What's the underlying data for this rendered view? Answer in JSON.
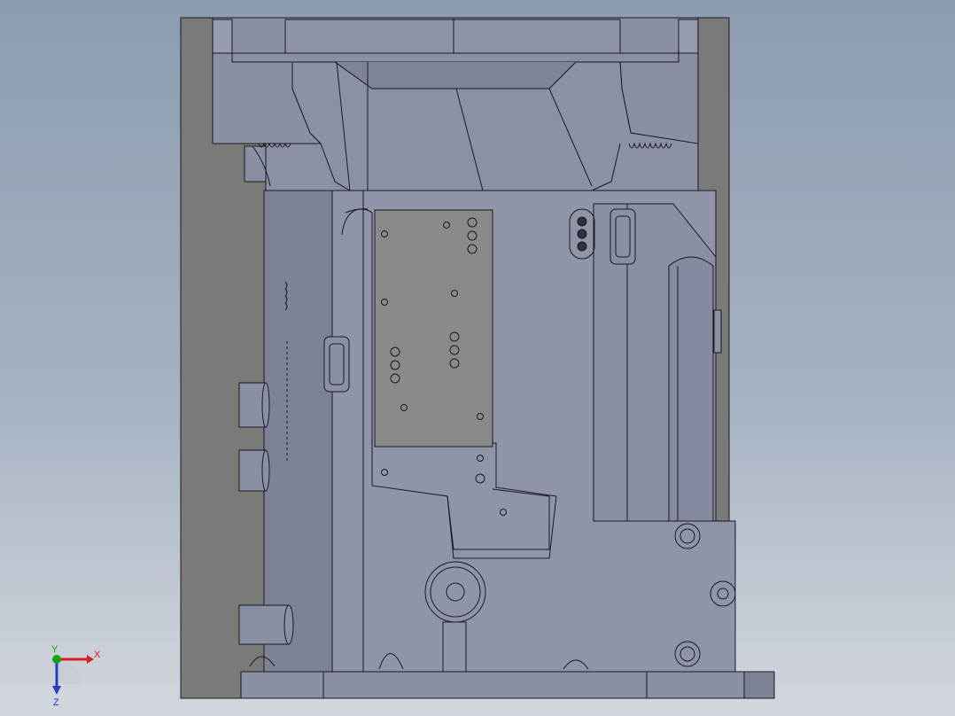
{
  "triad": {
    "x_label": "X",
    "y_label": "Y",
    "z_label": "Z",
    "colors": {
      "x": "#d42020",
      "y": "#18a018",
      "z": "#2040c8"
    }
  },
  "colors": {
    "viewport_top": "#8d9cb1",
    "viewport_bottom": "#d3d7dd",
    "mold_block": "#7a7a78",
    "part_body": "#8f94a8",
    "part_dark": "#7d8296",
    "plate": "#8a8a88",
    "edge": "#1a1a22"
  }
}
